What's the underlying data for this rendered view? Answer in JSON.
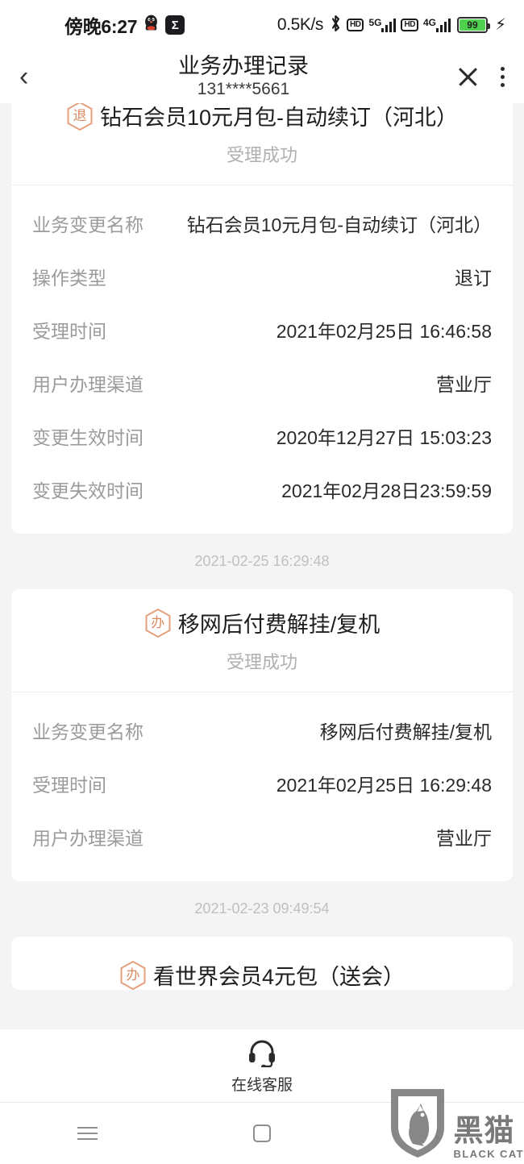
{
  "status_bar": {
    "clock": "傍晚6:27",
    "qq_icon": "qq-penguin-icon",
    "app_badge": "Σ",
    "net_speed": "0.5K/s",
    "bluetooth_icon": "bluetooth-icon",
    "sim1": {
      "hd": "HD",
      "gen": "5G"
    },
    "sim2": {
      "hd": "HD",
      "gen": "4G"
    },
    "battery_percent": "99",
    "charging_icon": "charging-bolt-icon"
  },
  "header": {
    "back_icon": "back-chevron-icon",
    "title": "业务办理记录",
    "subtitle": "131****5661",
    "close_icon": "close-icon",
    "menu_icon": "kebab-menu-icon"
  },
  "colors": {
    "page_bg": "#f4f4f4",
    "card_bg": "#ffffff",
    "accent_orange": "#e09a76",
    "label_gray": "#9b9b9b",
    "value_dark": "#2a2a2a",
    "status_gray": "#b0b0b0",
    "battery_green": "#4fd04f"
  },
  "records": [
    {
      "badge": "退",
      "title": "钻石会员10元月包-自动续订（河北）",
      "status": "受理成功",
      "rows": [
        {
          "label": "业务变更名称",
          "value": "钻石会员10元月包-自动续订（河北）"
        },
        {
          "label": "操作类型",
          "value": "退订"
        },
        {
          "label": "受理时间",
          "value": "2021年02月25日 16:46:58"
        },
        {
          "label": "用户办理渠道",
          "value": "营业厅"
        },
        {
          "label": "变更生效时间",
          "value": "2020年12月27日 15:03:23"
        },
        {
          "label": "变更失效时间",
          "value": "2021年02月28日23:59:59"
        }
      ]
    },
    {
      "badge": "办",
      "title": "移网后付费解挂/复机",
      "status": "受理成功",
      "rows": [
        {
          "label": "业务变更名称",
          "value": "移网后付费解挂/复机"
        },
        {
          "label": "受理时间",
          "value": "2021年02月25日 16:29:48"
        },
        {
          "label": "用户办理渠道",
          "value": "营业厅"
        }
      ]
    }
  ],
  "separator_times": [
    "2021-02-25 16:29:48",
    "2021-02-23 09:49:54"
  ],
  "partial_record": {
    "badge": "办",
    "title": "看世界会员4元包（送会）"
  },
  "service_bar": {
    "icon": "headset-icon",
    "label": "在线客服"
  },
  "nav_bar": {
    "recents_icon": "hamburger-recents-icon",
    "home_icon": "home-square-icon",
    "back_icon": "back-chevron-icon"
  },
  "watermark": {
    "logo_icon": "black-cat-shield-logo",
    "cn": "黑猫",
    "en": "BLACK CAT"
  }
}
